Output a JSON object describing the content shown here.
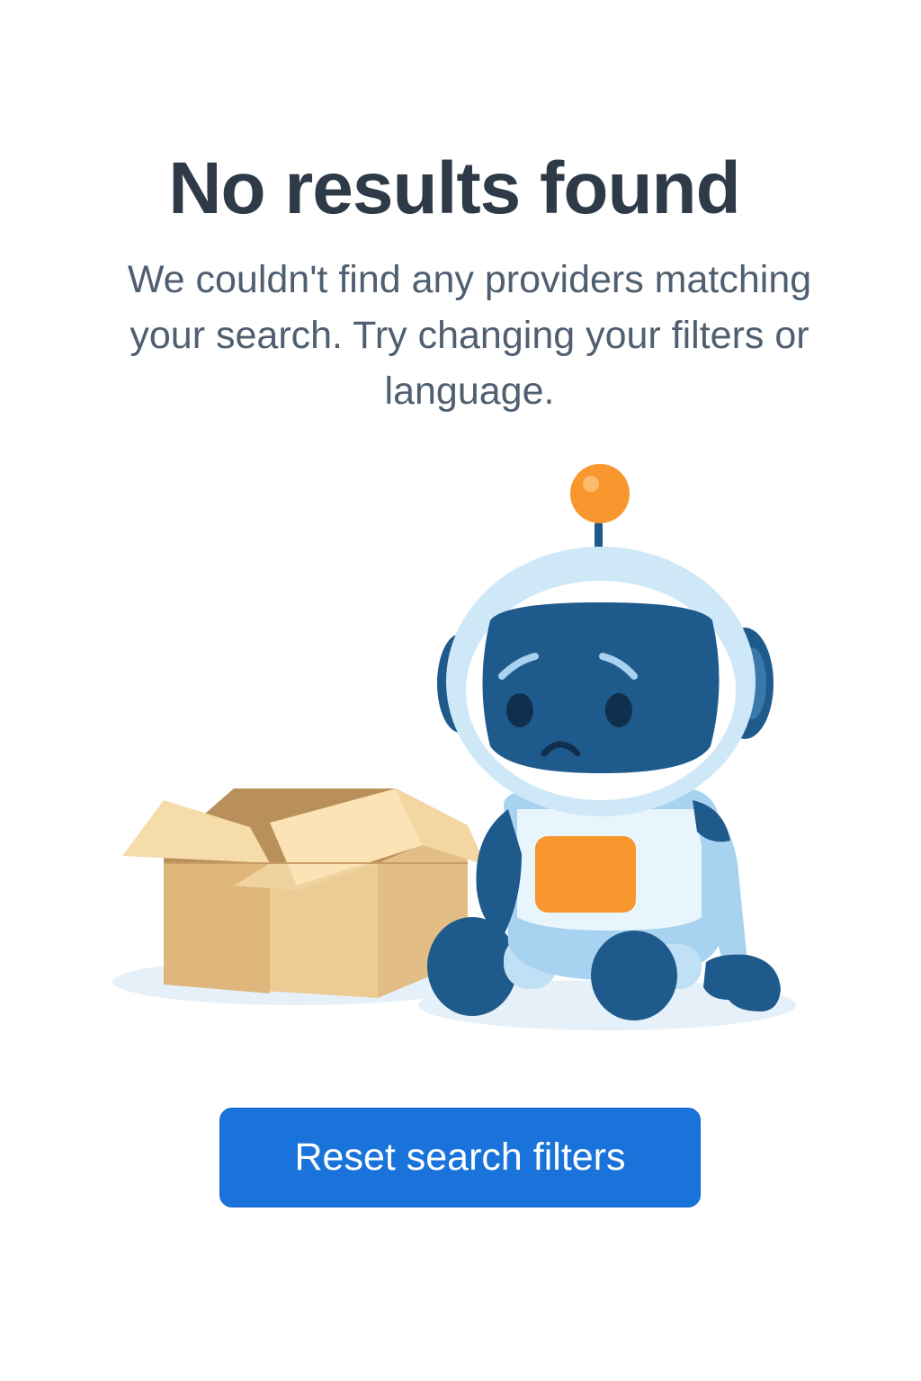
{
  "empty_state": {
    "title": "No results found",
    "message": "We couldn't find any providers matching your search. Try changing your filters or language.",
    "illustration": {
      "icons": [
        "sad-robot-icon",
        "empty-box-icon"
      ],
      "colors": {
        "robot_light": "#cfe8f7",
        "robot_dark": "#1f5a8c",
        "accent_orange": "#f7972d",
        "box_tan": "#e9c894"
      }
    },
    "action": {
      "label": "Reset search filters",
      "color": "#1a73da"
    }
  }
}
